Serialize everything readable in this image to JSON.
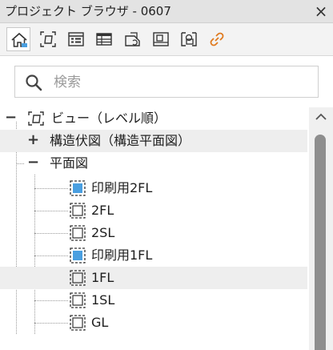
{
  "window": {
    "title": "プロジェクト ブラウザ - 0607",
    "close_glyph": "×"
  },
  "toolbar": {
    "buttons": [
      {
        "icon": "home-view-icon",
        "active": true
      },
      {
        "icon": "view-icon",
        "active": false
      },
      {
        "icon": "schedule-icon",
        "active": false
      },
      {
        "icon": "table-icon",
        "active": false
      },
      {
        "icon": "sheet-icon",
        "active": false
      },
      {
        "icon": "panel-icon",
        "active": false
      },
      {
        "icon": "group-icon",
        "active": false
      },
      {
        "icon": "link-icon",
        "active": false,
        "color": "#e07a1e"
      }
    ]
  },
  "search": {
    "placeholder": "検索",
    "value": ""
  },
  "tree": {
    "root": {
      "label": "ビュー（レベル順）",
      "expanded": true
    },
    "group1": {
      "label": "構造伏図（構造平面図）",
      "expanded": false,
      "sign": "+"
    },
    "group2": {
      "label": "平面図",
      "expanded": true,
      "sign": "−"
    },
    "items": [
      {
        "label": "印刷用2FL",
        "icon": "plan-view-filled-icon"
      },
      {
        "label": "2FL",
        "icon": "plan-view-icon"
      },
      {
        "label": "2SL",
        "icon": "plan-view-icon"
      },
      {
        "label": "印刷用1FL",
        "icon": "plan-view-filled-icon"
      },
      {
        "label": "1FL",
        "icon": "plan-view-icon",
        "highlighted": true
      },
      {
        "label": "1SL",
        "icon": "plan-view-icon"
      },
      {
        "label": "GL",
        "icon": "plan-view-icon"
      }
    ]
  },
  "colors": {
    "accent_blue": "#4a9fe0",
    "link_orange": "#e07a1e",
    "highlight_row": "#eeeeee"
  }
}
